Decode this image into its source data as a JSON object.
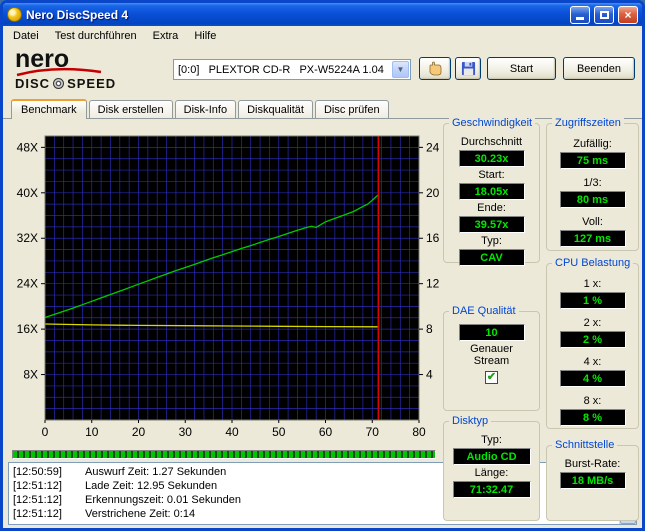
{
  "window": {
    "title": "Nero DiscSpeed 4"
  },
  "menu": {
    "items": [
      "Datei",
      "Test durchführen",
      "Extra",
      "Hilfe"
    ]
  },
  "toolbar": {
    "brand_name": "nero",
    "brand_disc": "DISC",
    "brand_speed": "SPEED",
    "drive_selector": "[0:0]   PLEXTOR CD-R   PX-W5224A 1.04",
    "start_button": "Start",
    "quit_button": "Beenden"
  },
  "tabs": {
    "items": [
      "Benchmark",
      "Disk erstellen",
      "Disk-Info",
      "Diskqualität",
      "Disc prüfen"
    ],
    "active_index": 0
  },
  "chart_data": {
    "type": "line",
    "background": "#000000",
    "grid_color": "#2A2AB4",
    "x_axis": {
      "min": 0,
      "max": 80,
      "minor_step": 2,
      "ticks": [
        0,
        10,
        20,
        30,
        40,
        50,
        60,
        70,
        80
      ]
    },
    "y_axis_left": {
      "min": 0,
      "max": 50,
      "minor_step": 2,
      "tick_values": [
        48,
        40,
        32,
        24,
        16,
        8
      ],
      "tick_labels": [
        "48X",
        "40X",
        "32X",
        "24X",
        "16X",
        "8X"
      ]
    },
    "y_axis_right": {
      "min": 0,
      "max": 25,
      "tick_values": [
        24,
        20,
        16,
        12,
        8,
        4
      ],
      "tick_labels": [
        "24",
        "20",
        "16",
        "12",
        "8",
        "4"
      ]
    },
    "series": [
      {
        "name": "read-speed",
        "color": "#00CC00",
        "points": [
          [
            0,
            18.05
          ],
          [
            2,
            18.6
          ],
          [
            4,
            19.15
          ],
          [
            6,
            19.7
          ],
          [
            8,
            20.3
          ],
          [
            10,
            20.9
          ],
          [
            12,
            21.5
          ],
          [
            14,
            22.1
          ],
          [
            16,
            22.7
          ],
          [
            18,
            23.3
          ],
          [
            20,
            23.9
          ],
          [
            22,
            24.5
          ],
          [
            24,
            25.1
          ],
          [
            26,
            25.7
          ],
          [
            28,
            26.3
          ],
          [
            30,
            26.85
          ],
          [
            32,
            27.4
          ],
          [
            34,
            28.0
          ],
          [
            36,
            28.55
          ],
          [
            38,
            29.1
          ],
          [
            40,
            29.65
          ],
          [
            42,
            30.2
          ],
          [
            44,
            30.7
          ],
          [
            46,
            31.25
          ],
          [
            48,
            31.8
          ],
          [
            50,
            32.3
          ],
          [
            52,
            32.85
          ],
          [
            54,
            33.4
          ],
          [
            56,
            33.9
          ],
          [
            57,
            34.1
          ],
          [
            58,
            33.9
          ],
          [
            60,
            34.9
          ],
          [
            62,
            35.5
          ],
          [
            64,
            36.1
          ],
          [
            66,
            36.7
          ],
          [
            68,
            37.6
          ],
          [
            69,
            38.0
          ],
          [
            70,
            38.7
          ],
          [
            70.8,
            39.3
          ],
          [
            71.2,
            39.57
          ]
        ]
      },
      {
        "name": "rotation-speed",
        "color": "#D8D800",
        "points": [
          [
            0,
            16.9
          ],
          [
            10,
            16.75
          ],
          [
            20,
            16.65
          ],
          [
            30,
            16.6
          ],
          [
            40,
            16.55
          ],
          [
            50,
            16.5
          ],
          [
            60,
            16.45
          ],
          [
            71.2,
            16.4
          ]
        ]
      }
    ],
    "end_marker": {
      "x": 71.3,
      "color": "#DD0000"
    }
  },
  "panels": {
    "speed": {
      "title": "Geschwindigkeit",
      "rows": [
        {
          "label": "Durchschnitt",
          "value": "30.23x"
        },
        {
          "label": "Start:",
          "value": "18.05x"
        },
        {
          "label": "Ende:",
          "value": "39.57x"
        },
        {
          "label": "Typ:",
          "value": "CAV"
        }
      ]
    },
    "access": {
      "title": "Zugriffszeiten",
      "rows": [
        {
          "label": "Zufällig:",
          "value": "75 ms"
        },
        {
          "label": "1/3:",
          "value": "80 ms"
        },
        {
          "label": "Voll:",
          "value": "127 ms"
        }
      ]
    },
    "cpu": {
      "title": "CPU Belastung",
      "rows": [
        {
          "label": "1 x:",
          "value": "1 %"
        },
        {
          "label": "2 x:",
          "value": "2 %"
        },
        {
          "label": "4 x:",
          "value": "4 %"
        },
        {
          "label": "8 x:",
          "value": "8 %"
        }
      ]
    },
    "dae": {
      "title": "DAE Qualität",
      "value": "10",
      "stream_label": "Genauer Stream",
      "stream_checked": true,
      "check_glyph": "✔"
    },
    "disc": {
      "title": "Disktyp",
      "rows": [
        {
          "label": "Typ:",
          "value": "Audio CD"
        },
        {
          "label": "Länge:",
          "value": "71:32.47"
        }
      ]
    },
    "interface": {
      "title": "Schnittstelle",
      "rows": [
        {
          "label": "Burst-Rate:",
          "value": "18 MB/s"
        }
      ]
    }
  },
  "progress": {
    "percent": 100
  },
  "log": {
    "lines": [
      {
        "time": "[12:50:59]",
        "text": "Auswurf Zeit: 1.27 Sekunden"
      },
      {
        "time": "[12:51:12]",
        "text": "Lade Zeit: 12.95 Sekunden"
      },
      {
        "time": "[12:51:12]",
        "text": "Erkennungszeit: 0.01 Sekunden"
      },
      {
        "time": "[12:51:12]",
        "text": "Verstrichene Zeit: 0:14"
      }
    ]
  }
}
